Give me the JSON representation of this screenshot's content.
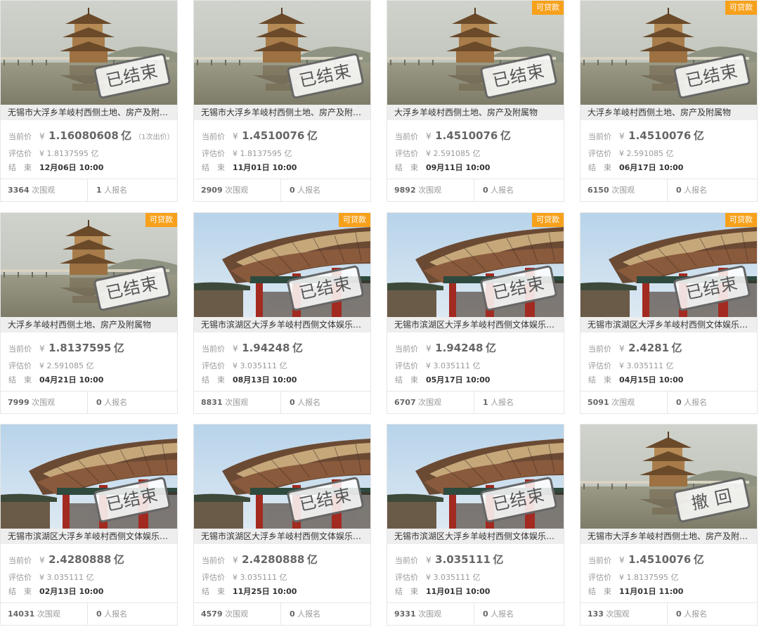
{
  "labels": {
    "current_price": "当前价",
    "estimate": "评估价",
    "end": "结　束",
    "yen": "¥",
    "views_suffix": "次围观",
    "reg_suffix": "人报名",
    "loan_badge": "可贷款"
  },
  "items": [
    {
      "image": "pavilion",
      "loan": false,
      "stamp": "已结束",
      "title": "无锡市大浮乡羊岐村西侧土地、房产及附属物",
      "price": "1.16080608",
      "unit": "亿",
      "note": "（1次出价）",
      "estimate": "¥ 1.8137595 亿",
      "end": "12月06日 10:00",
      "views": "3364",
      "registrations": "1"
    },
    {
      "image": "pavilion",
      "loan": false,
      "stamp": "已结束",
      "title": "无锡市大浮乡羊岐村西侧土地、房产及附属物",
      "price": "1.4510076",
      "unit": "亿",
      "note": "",
      "estimate": "¥ 1.8137595 亿",
      "end": "11月01日 10:00",
      "views": "2909",
      "registrations": "0"
    },
    {
      "image": "pavilion",
      "loan": true,
      "stamp": "已结束",
      "title": "大浮乡羊岐村西侧土地、房产及附属物",
      "price": "1.4510076",
      "unit": "亿",
      "note": "",
      "estimate": "¥ 2.591085 亿",
      "end": "09月11日 10:00",
      "views": "9892",
      "registrations": "0"
    },
    {
      "image": "pavilion",
      "loan": true,
      "stamp": "已结束",
      "title": "大浮乡羊岐村西侧土地、房产及附属物",
      "price": "1.4510076",
      "unit": "亿",
      "note": "",
      "estimate": "¥ 2.591085 亿",
      "end": "06月17日 10:00",
      "views": "6150",
      "registrations": "0"
    },
    {
      "image": "pavilion",
      "loan": true,
      "stamp": "已结束",
      "title": "大浮乡羊岐村西侧土地、房产及附属物",
      "price": "1.8137595",
      "unit": "亿",
      "note": "",
      "estimate": "¥ 2.591085 亿",
      "end": "04月21日 10:00",
      "views": "7999",
      "registrations": "0"
    },
    {
      "image": "hall",
      "loan": true,
      "stamp": "已结束",
      "title": "无锡市滨湖区大浮乡羊岐村西侧文体娱乐用地",
      "price": "1.94248",
      "unit": "亿",
      "note": "",
      "estimate": "¥ 3.035111 亿",
      "end": "08月13日 10:00",
      "views": "8831",
      "registrations": "0"
    },
    {
      "image": "hall",
      "loan": true,
      "stamp": "已结束",
      "title": "无锡市滨湖区大浮乡羊岐村西侧文体娱乐用地",
      "price": "1.94248",
      "unit": "亿",
      "note": "",
      "estimate": "¥ 3.035111 亿",
      "end": "05月17日 10:00",
      "views": "6707",
      "registrations": "1"
    },
    {
      "image": "hall",
      "loan": true,
      "stamp": "已结束",
      "title": "无锡市滨湖区大浮乡羊岐村西侧文体娱乐用地",
      "price": "2.4281",
      "unit": "亿",
      "note": "",
      "estimate": "¥ 3.035111 亿",
      "end": "04月15日 10:00",
      "views": "5091",
      "registrations": "0"
    },
    {
      "image": "hall",
      "loan": false,
      "stamp": "已结束",
      "title": "无锡市滨湖区大浮乡羊岐村西侧文体娱乐用地",
      "price": "2.4280888",
      "unit": "亿",
      "note": "",
      "estimate": "¥ 3.035111 亿",
      "end": "02月13日 10:00",
      "views": "14031",
      "registrations": "0"
    },
    {
      "image": "hall",
      "loan": false,
      "stamp": "已结束",
      "title": "无锡市滨湖区大浮乡羊岐村西侧文体娱乐用地",
      "price": "2.4280888",
      "unit": "亿",
      "note": "",
      "estimate": "¥ 3.035111 亿",
      "end": "11月25日 10:00",
      "views": "4579",
      "registrations": "0"
    },
    {
      "image": "hall",
      "loan": false,
      "stamp": "已结束",
      "title": "无锡市滨湖区大浮乡羊岐村西侧文体娱乐用地",
      "price": "3.035111",
      "unit": "亿",
      "note": "",
      "estimate": "¥ 3.035111 亿",
      "end": "11月01日 10:00",
      "views": "9331",
      "registrations": "0"
    },
    {
      "image": "pavilion",
      "loan": false,
      "stamp": "撤 回",
      "title": "无锡市大浮乡羊岐村西侧土地、房产及附属物",
      "price": "1.4510076",
      "unit": "亿",
      "note": "",
      "estimate": "¥ 1.8137595 亿",
      "end": "11月01日 11:00",
      "views": "133",
      "registrations": "0"
    }
  ]
}
